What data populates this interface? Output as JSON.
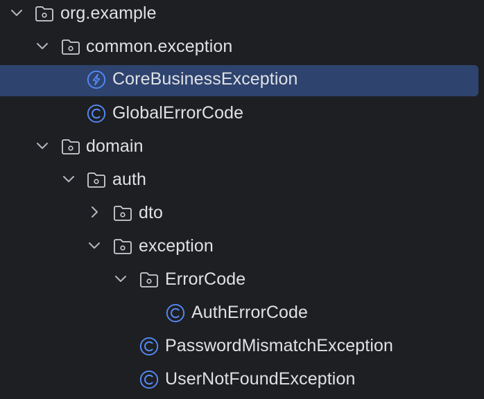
{
  "project_tree": {
    "accent_icon_color": "#548af7",
    "selection_color": "#2e436e",
    "text_color": "#dfe1e5",
    "nodes": [
      {
        "label": "org.example",
        "kind": "package",
        "expanded": true,
        "icon": "folder-package-icon"
      },
      {
        "label": "common.exception",
        "kind": "package",
        "expanded": true,
        "icon": "folder-package-icon"
      },
      {
        "label": "CoreBusinessException",
        "kind": "exception-class",
        "selected": true,
        "icon": "exception-class-icon"
      },
      {
        "label": "GlobalErrorCode",
        "kind": "class",
        "icon": "class-icon"
      },
      {
        "label": "domain",
        "kind": "package",
        "expanded": true,
        "icon": "folder-package-icon"
      },
      {
        "label": "auth",
        "kind": "package",
        "expanded": true,
        "icon": "folder-package-icon"
      },
      {
        "label": "dto",
        "kind": "package",
        "expanded": false,
        "icon": "folder-package-icon"
      },
      {
        "label": "exception",
        "kind": "package",
        "expanded": true,
        "icon": "folder-package-icon"
      },
      {
        "label": "ErrorCode",
        "kind": "package",
        "expanded": true,
        "icon": "folder-package-icon"
      },
      {
        "label": "AuthErrorCode",
        "kind": "class",
        "icon": "class-icon"
      },
      {
        "label": "PasswordMismatchException",
        "kind": "class",
        "icon": "class-icon"
      },
      {
        "label": "UserNotFoundException",
        "kind": "class",
        "icon": "class-icon"
      }
    ]
  }
}
